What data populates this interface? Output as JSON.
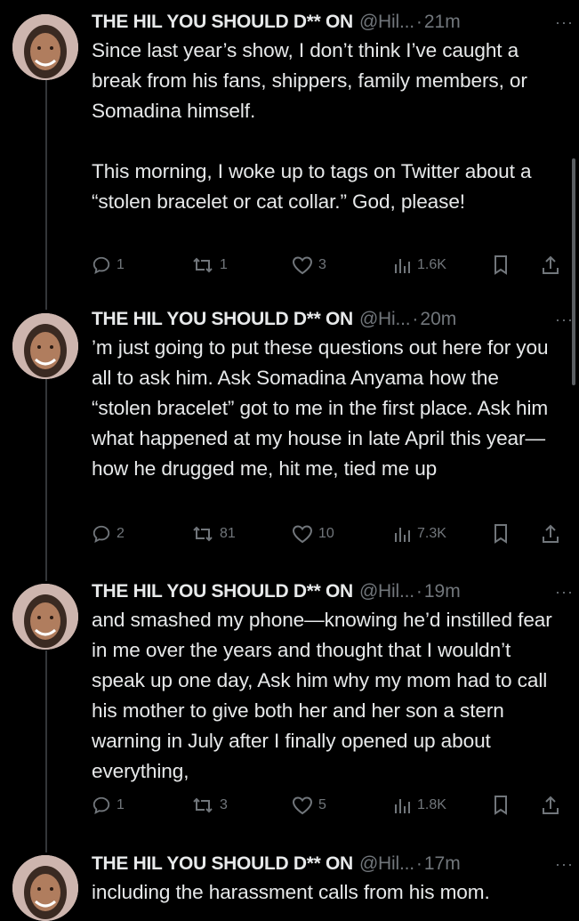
{
  "tweets": [
    {
      "name": "THE HIL YOU SHOULD D** ON",
      "handle": "@Hil...",
      "time": "21m",
      "paragraphs": [
        "Since last year’s show, I don’t think I’ve caught a break from his fans, shippers, family members, or Somadina himself.",
        "This morning, I woke up to tags on Twitter about a “stolen bracelet or cat collar.” God, please!"
      ],
      "replies": "1",
      "reposts": "1",
      "likes": "3",
      "views": "1.6K"
    },
    {
      "name": "THE HIL YOU SHOULD D** ON",
      "handle": "@Hi...",
      "time": "20m",
      "paragraphs": [
        "’m just going to put these questions out here for you all to ask him. Ask Somadina Anyama how the “stolen bracelet” got to me in the first place. Ask him what happened at my house in late April this year—how he drugged me, hit me, tied me up"
      ],
      "replies": "2",
      "reposts": "81",
      "likes": "10",
      "views": "7.3K"
    },
    {
      "name": "THE HIL YOU SHOULD D** ON",
      "handle": "@Hil...",
      "time": "19m",
      "paragraphs": [
        "and smashed my phone—knowing he’d instilled fear in me over the years and thought that I wouldn’t speak up one day, Ask him why my mom had to call his mother to give both her and her son a stern warning in July after I finally opened up about everything,"
      ],
      "replies": "1",
      "reposts": "3",
      "likes": "5",
      "views": "1.8K"
    },
    {
      "name": "THE HIL YOU SHOULD D** ON",
      "handle": "@Hil...",
      "time": "17m",
      "paragraphs": [
        "including the harassment calls from his mom."
      ]
    }
  ],
  "dot": "·",
  "more": "···",
  "icons": {
    "reply": "reply-icon",
    "repost": "repost-icon",
    "like": "heart-icon",
    "views": "views-icon",
    "bookmark": "bookmark-icon",
    "share": "share-icon",
    "more": "more-icon"
  },
  "colors": {
    "background": "#000000",
    "text": "#e7e9ea",
    "muted": "#71767b",
    "thread": "#333639"
  }
}
